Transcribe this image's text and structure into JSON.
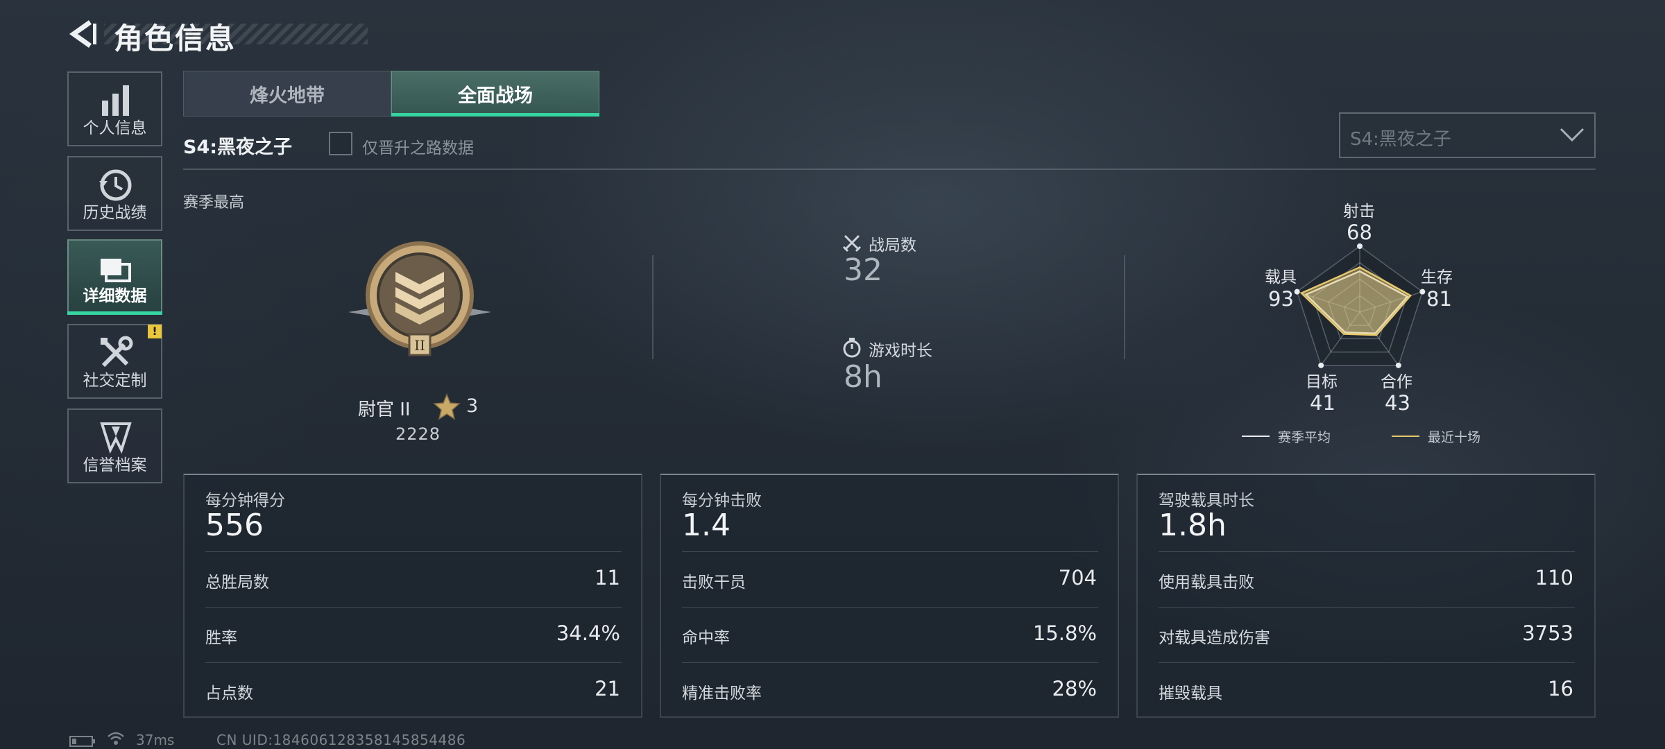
{
  "header": {
    "title": "角色信息"
  },
  "sidebar": {
    "items": [
      {
        "label": "个人信息",
        "icon": "bar-chart-icon"
      },
      {
        "label": "历史战绩",
        "icon": "history-clock-icon"
      },
      {
        "label": "详细数据",
        "icon": "cards-icon",
        "active": true
      },
      {
        "label": "社交定制",
        "icon": "tools-icon",
        "badge": "!"
      },
      {
        "label": "信誉档案",
        "icon": "shield-emblem-icon"
      }
    ]
  },
  "tabs": [
    {
      "label": "烽火地带"
    },
    {
      "label": "全面战场",
      "active": true
    }
  ],
  "season": {
    "name": "S4:黑夜之子",
    "checkbox_label": "仅晋升之路数据",
    "checkbox_checked": false,
    "select_value": "S4:黑夜之子"
  },
  "best": {
    "label": "赛季最高",
    "rank_name": "尉官 II",
    "stars": "3",
    "points": "2228"
  },
  "summary": {
    "matches_label": "战局数",
    "matches_value": "32",
    "time_label": "游戏时长",
    "time_value": "8h"
  },
  "radar": {
    "axes": [
      {
        "label": "射击",
        "value": "68"
      },
      {
        "label": "生存",
        "value": "81"
      },
      {
        "label": "合作",
        "value": "43"
      },
      {
        "label": "目标",
        "value": "41"
      },
      {
        "label": "载具",
        "value": "93"
      }
    ],
    "legend": [
      {
        "label": "赛季平均",
        "color": "#e8ecef"
      },
      {
        "label": "最近十场",
        "color": "#e6c86a"
      }
    ],
    "series": {
      "recent": [
        68,
        81,
        43,
        41,
        93
      ],
      "average": [
        62,
        76,
        40,
        38,
        86
      ]
    },
    "max": 100
  },
  "panels": [
    {
      "title": "每分钟得分",
      "value": "556",
      "rows": [
        {
          "label": "总胜局数",
          "value": "11"
        },
        {
          "label": "胜率",
          "value": "34.4%"
        },
        {
          "label": "占点数",
          "value": "21"
        }
      ]
    },
    {
      "title": "每分钟击败",
      "value": "1.4",
      "rows": [
        {
          "label": "击败干员",
          "value": "704"
        },
        {
          "label": "命中率",
          "value": "15.8%"
        },
        {
          "label": "精准击败率",
          "value": "28%"
        }
      ]
    },
    {
      "title": "驾驶载具时长",
      "value": "1.8h",
      "rows": [
        {
          "label": "使用载具击败",
          "value": "110"
        },
        {
          "label": "对载具造成伤害",
          "value": "3753"
        },
        {
          "label": "摧毁载具",
          "value": "16"
        }
      ]
    }
  ],
  "footer": {
    "ping": "37ms",
    "uid": "CN UID:1846061283581458544​86"
  }
}
